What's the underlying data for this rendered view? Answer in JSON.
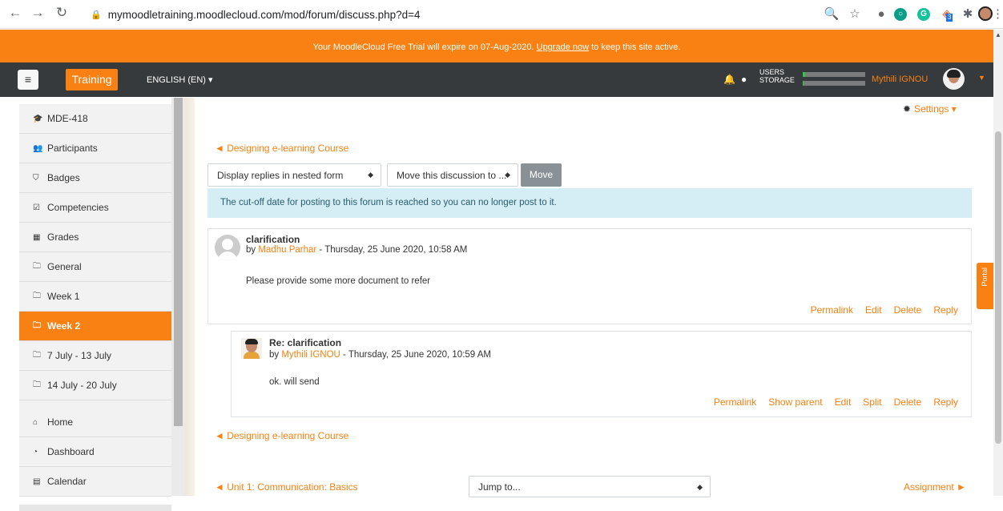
{
  "browser": {
    "url": "mymoodletraining.moodlecloud.com/mod/forum/discuss.php?d=4",
    "extension_badge": "3"
  },
  "banner": {
    "text_before": "Your MoodleCloud Free Trial will expire on 07-Aug-2020. ",
    "link": "Upgrade now",
    "text_after": " to keep this site active."
  },
  "navbar": {
    "brand": "Training",
    "language": "ENGLISH (EN) ▾",
    "usage_users": "USERS",
    "usage_storage": "STORAGE",
    "users_fill": 0.04,
    "storage_fill": 0.01,
    "user_name": "Mythili IGNOU"
  },
  "sidebar": {
    "items": [
      {
        "label": "MDE-418",
        "icon": "graduation-cap-icon",
        "glyph": "🎓"
      },
      {
        "label": "Participants",
        "icon": "users-icon",
        "glyph": "👥"
      },
      {
        "label": "Badges",
        "icon": "shield-icon",
        "glyph": "⛉"
      },
      {
        "label": "Competencies",
        "icon": "checkbox-icon",
        "glyph": "☑"
      },
      {
        "label": "Grades",
        "icon": "table-icon",
        "glyph": "▦"
      },
      {
        "label": "General",
        "icon": "folder-icon",
        "glyph": "🗀"
      },
      {
        "label": "Week 1",
        "icon": "folder-icon",
        "glyph": "🗀"
      },
      {
        "label": "Week 2",
        "icon": "folder-icon",
        "glyph": "🗀"
      },
      {
        "label": "7 July - 13 July",
        "icon": "folder-icon",
        "glyph": "🗀"
      },
      {
        "label": "14 July - 20 July",
        "icon": "folder-icon",
        "glyph": "🗀"
      },
      {
        "label": "Home",
        "icon": "home-icon",
        "glyph": "⌂"
      },
      {
        "label": "Dashboard",
        "icon": "dashboard-icon",
        "glyph": "◔"
      },
      {
        "label": "Calendar",
        "icon": "calendar-icon",
        "glyph": "▤"
      }
    ]
  },
  "main": {
    "settings": "Settings",
    "back_link": "◄ Designing e-learning Course",
    "display_select": "Display replies in nested form",
    "move_select": "Move this discussion to ...",
    "move_button": "Move",
    "notice": "The cut-off date for posting to this forum is reached so you can no longer post to it.",
    "posts": [
      {
        "title": "clarification",
        "by": "by ",
        "author": "Madhu Parhar",
        "date": " - Thursday, 25 June 2020, 10:58 AM",
        "message": "Please provide some more document to refer",
        "commands": [
          "Permalink",
          "Edit",
          "Delete",
          "Reply"
        ]
      },
      {
        "title": "Re: clarification",
        "by": "by ",
        "author": "Mythili IGNOU",
        "date": " - Thursday, 25 June 2020, 10:59 AM",
        "message": "ok. will send",
        "commands": [
          "Permalink",
          "Show parent",
          "Edit",
          "Split",
          "Delete",
          "Reply"
        ]
      }
    ],
    "bottom_back_link": "◄ Designing e-learning Course",
    "prev_activity": "◄ Unit 1: Communication: Basics",
    "jump_to": "Jump to...",
    "next_activity": "Assignment ►"
  }
}
